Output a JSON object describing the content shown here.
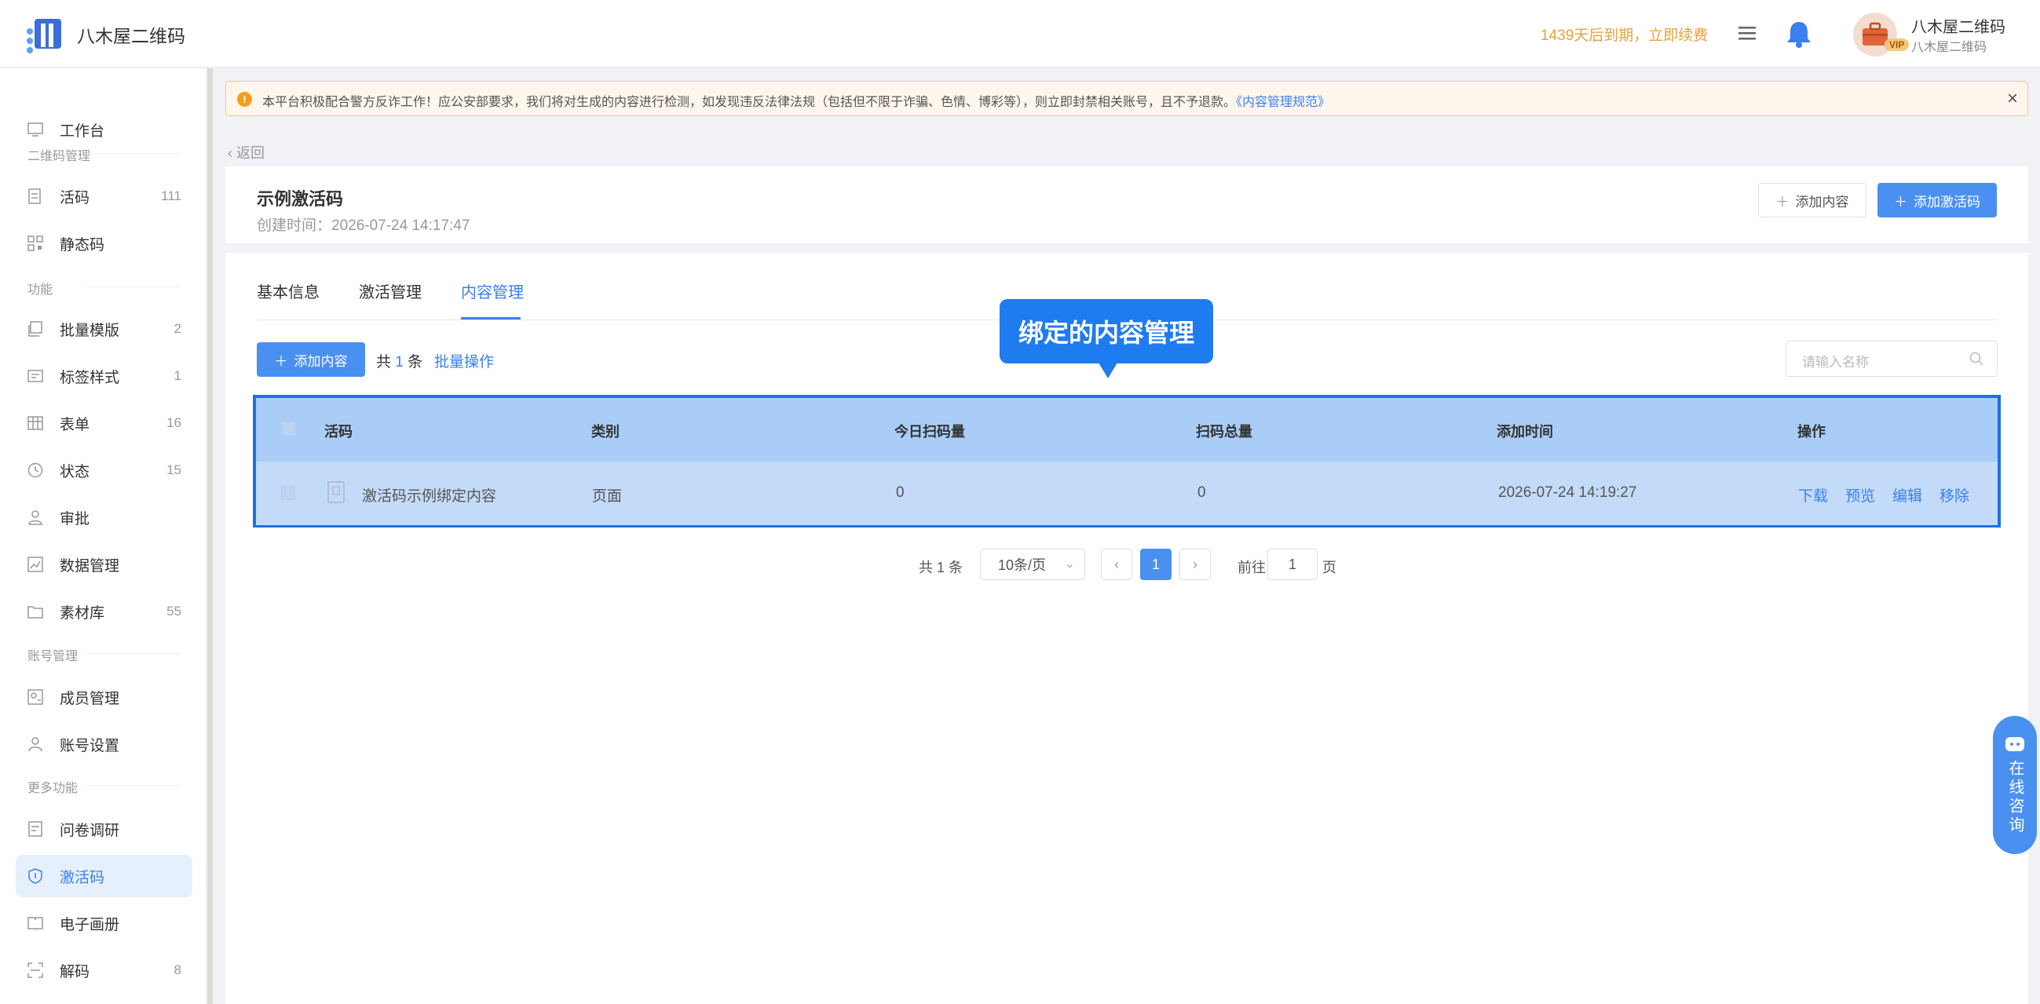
{
  "header": {
    "logo_text": "八木屋二维码",
    "expiry_notice": "1439天后到期，立即续费",
    "user_name": "八木屋二维码",
    "user_sub": "八木屋二维码",
    "vip_badge": "VIP"
  },
  "sidebar": {
    "items": [
      {
        "label": "工作台",
        "count": ""
      },
      {
        "label": "活码",
        "count": "111"
      },
      {
        "label": "静态码",
        "count": ""
      },
      {
        "label": "批量模版",
        "count": "2"
      },
      {
        "label": "标签样式",
        "count": "1"
      },
      {
        "label": "表单",
        "count": "16"
      },
      {
        "label": "状态",
        "count": "15"
      },
      {
        "label": "审批",
        "count": ""
      },
      {
        "label": "数据管理",
        "count": ""
      },
      {
        "label": "素材库",
        "count": "55"
      },
      {
        "label": "成员管理",
        "count": ""
      },
      {
        "label": "账号设置",
        "count": ""
      },
      {
        "label": "问卷调研",
        "count": ""
      },
      {
        "label": "激活码",
        "count": ""
      },
      {
        "label": "电子画册",
        "count": ""
      },
      {
        "label": "解码",
        "count": "8"
      }
    ],
    "groups": [
      "二维码管理",
      "功能",
      "账号管理",
      "更多功能"
    ]
  },
  "notice": {
    "text": "本平台积极配合警方反诈工作！应公安部要求，我们将对生成的内容进行检测，如发现违反法律法规（包括但不限于诈骗、色情、博彩等），则立即封禁相关账号，且不予退款。",
    "link": "《内容管理规范》",
    "close": "×"
  },
  "back_label": "返回",
  "page": {
    "title": "示例激活码",
    "created": "创建时间：2026-07-24 14:17:47",
    "btn_add_content": "添加内容",
    "btn_add_code": "添加激活码"
  },
  "tabs": [
    "基本信息",
    "激活管理",
    "内容管理"
  ],
  "toolbar": {
    "add_btn": "添加内容",
    "total_prefix": "共",
    "total_num": "1",
    "total_suffix": "条",
    "batch": "批量操作",
    "search_placeholder": "请输入名称"
  },
  "tooltip": "绑定的内容管理",
  "table": {
    "columns": [
      "活码",
      "类别",
      "今日扫码量",
      "扫码总量",
      "添加时间",
      "操作"
    ],
    "rows": [
      {
        "name": "激活码示例绑定内容",
        "category": "页面",
        "today": "0",
        "total": "0",
        "time": "2026-07-24 14:19:27",
        "actions": [
          "下载",
          "预览",
          "编辑",
          "移除"
        ]
      }
    ]
  },
  "pagination": {
    "total": "共 1 条",
    "page_size": "10条/页",
    "current": "1",
    "goto_label": "前往",
    "goto_value": "1",
    "page_suffix": "页"
  },
  "consult": "在线咨询",
  "colors": {
    "primary": "#4a90f0",
    "highlight_border": "#1f6fe8",
    "warning": "#e6a23c"
  }
}
